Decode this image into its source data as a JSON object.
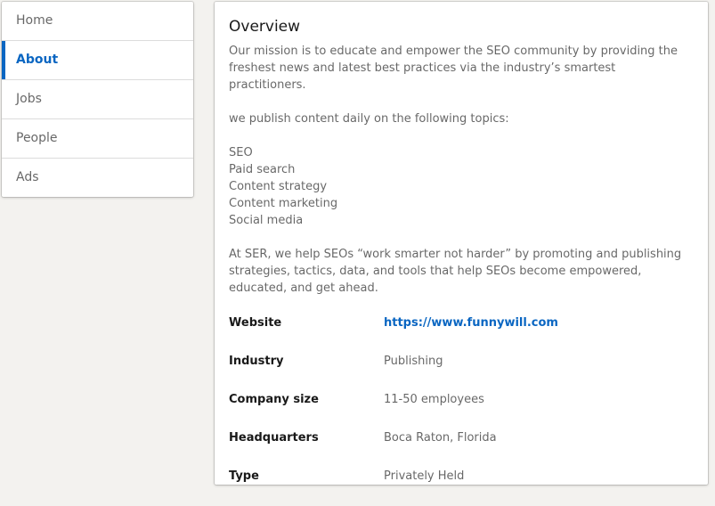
{
  "nav": {
    "items": [
      {
        "label": "Home"
      },
      {
        "label": "About"
      },
      {
        "label": "Jobs"
      },
      {
        "label": "People"
      },
      {
        "label": "Ads"
      }
    ],
    "active_index": 1
  },
  "overview": {
    "title": "Overview",
    "mission": "Our mission is to educate and empower the SEO community by providing the freshest news and latest best practices via the industry’s smartest practitioners.",
    "topics_intro": "we publish content daily on the following topics:",
    "topics": [
      "SEO",
      "Paid search",
      "Content strategy",
      "Content marketing",
      "Social media"
    ],
    "closing": "At SER, we help SEOs “work smarter not harder” by promoting and publishing strategies, tactics, data, and tools that help SEOs become empowered, educated, and get ahead."
  },
  "details": {
    "website": {
      "label": "Website",
      "value": "https://www.funnywill.com"
    },
    "industry": {
      "label": "Industry",
      "value": "Publishing"
    },
    "company_size": {
      "label": "Company size",
      "value": "11-50 employees"
    },
    "headquarters": {
      "label": "Headquarters",
      "value": "Boca Raton, Florida"
    },
    "type": {
      "label": "Type",
      "value": "Privately Held"
    }
  },
  "colors": {
    "accent": "#0a66c2",
    "background": "#f3f2ef"
  }
}
